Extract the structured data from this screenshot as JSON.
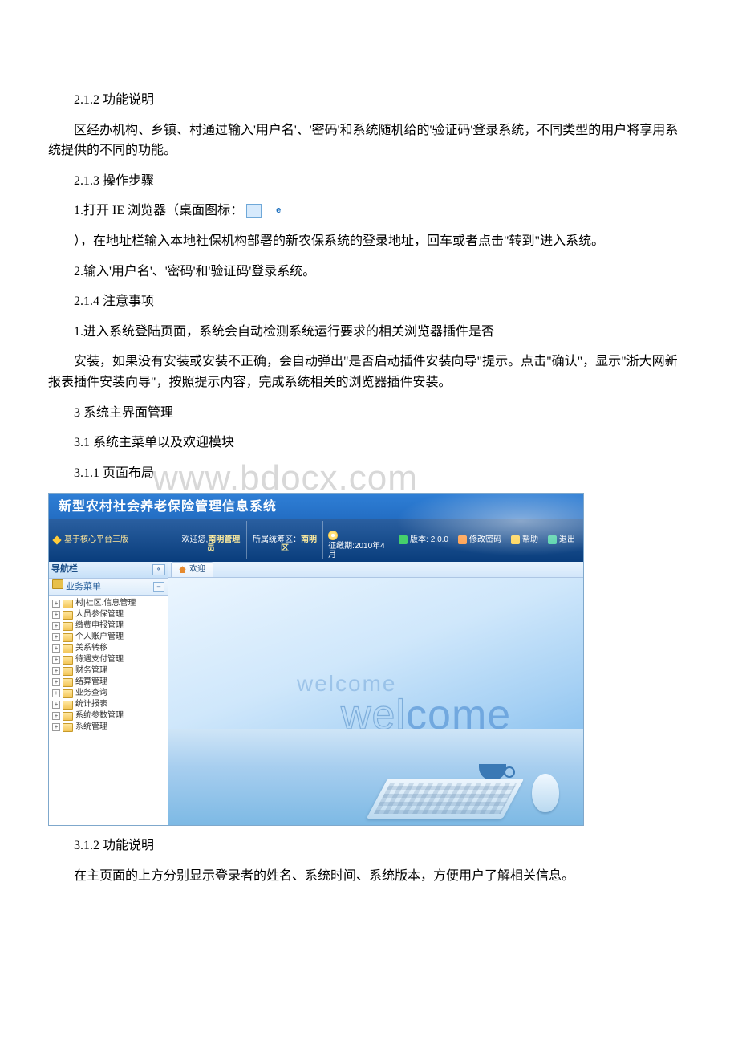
{
  "watermark": "www.bdocx.com",
  "doc": {
    "s212_title": "2.1.2 功能说明",
    "s212_body": "区经办机构、乡镇、村通过输入'用户名'、'密码'和系统随机给的'验证码'登录系统，不同类型的用户将享用系统提供的不同的功能。",
    "s213_title": "2.1.3 操作步骤",
    "s213_step1_a": "1.打开 IE 浏览器（桌面图标：",
    "s213_step1_b": "），在地址栏输入本地社保机构部署的新农保系统的登录地址，回车或者点击\"转到\"进入系统。",
    "s213_step2": "2.输入'用户名'、'密码'和'验证码'登录系统。",
    "s214_title": "2.1.4 注意事项",
    "s214_line1": "1.进入系统登陆页面，系统会自动检测系统运行要求的相关浏览器插件是否",
    "s214_line2": "安装，如果没有安装或安装不正确，会自动弹出\"是否启动插件安装向导\"提示。点击\"确认\"，显示\"浙大网新报表插件安装向导\"，按照提示内容，完成系统相关的浏览器插件安装。",
    "s3_title": "3 系统主界面管理",
    "s31_title": "3.1 系统主菜单以及欢迎模块",
    "s311_title": "3.1.1 页面布局",
    "s312_title": "3.1.2 功能说明",
    "s312_body": "在主页面的上方分别显示登录者的姓名、系统时间、系统版本，方便用户了解相关信息。"
  },
  "app": {
    "title": "新型农村社会养老保险管理信息系统",
    "subtitle": "基于核心平台三版",
    "welcome_prefix": "欢迎您,",
    "welcome_user": "南明管理员",
    "region_label": "所属统筹区：",
    "region_value": "南明区",
    "period_label": "征缴期:",
    "period_value": "2010年4月",
    "version_label": "版本:",
    "version_value": "2.0.0",
    "btn_pwd": "修改密码",
    "btn_help": "帮助",
    "btn_exit": "退出",
    "nav_title": "导航栏",
    "menu_title": "业务菜单",
    "tab_welcome": "欢迎",
    "welcome_text": "welcome",
    "tree": [
      "村|社区.信息管理",
      "人员参保管理",
      "缴费申报管理",
      "个人账户管理",
      "关系转移",
      "待遇支付管理",
      "财务管理",
      "结算管理",
      "业务查询",
      "统计报表",
      "系统参数管理",
      "系统管理"
    ]
  }
}
